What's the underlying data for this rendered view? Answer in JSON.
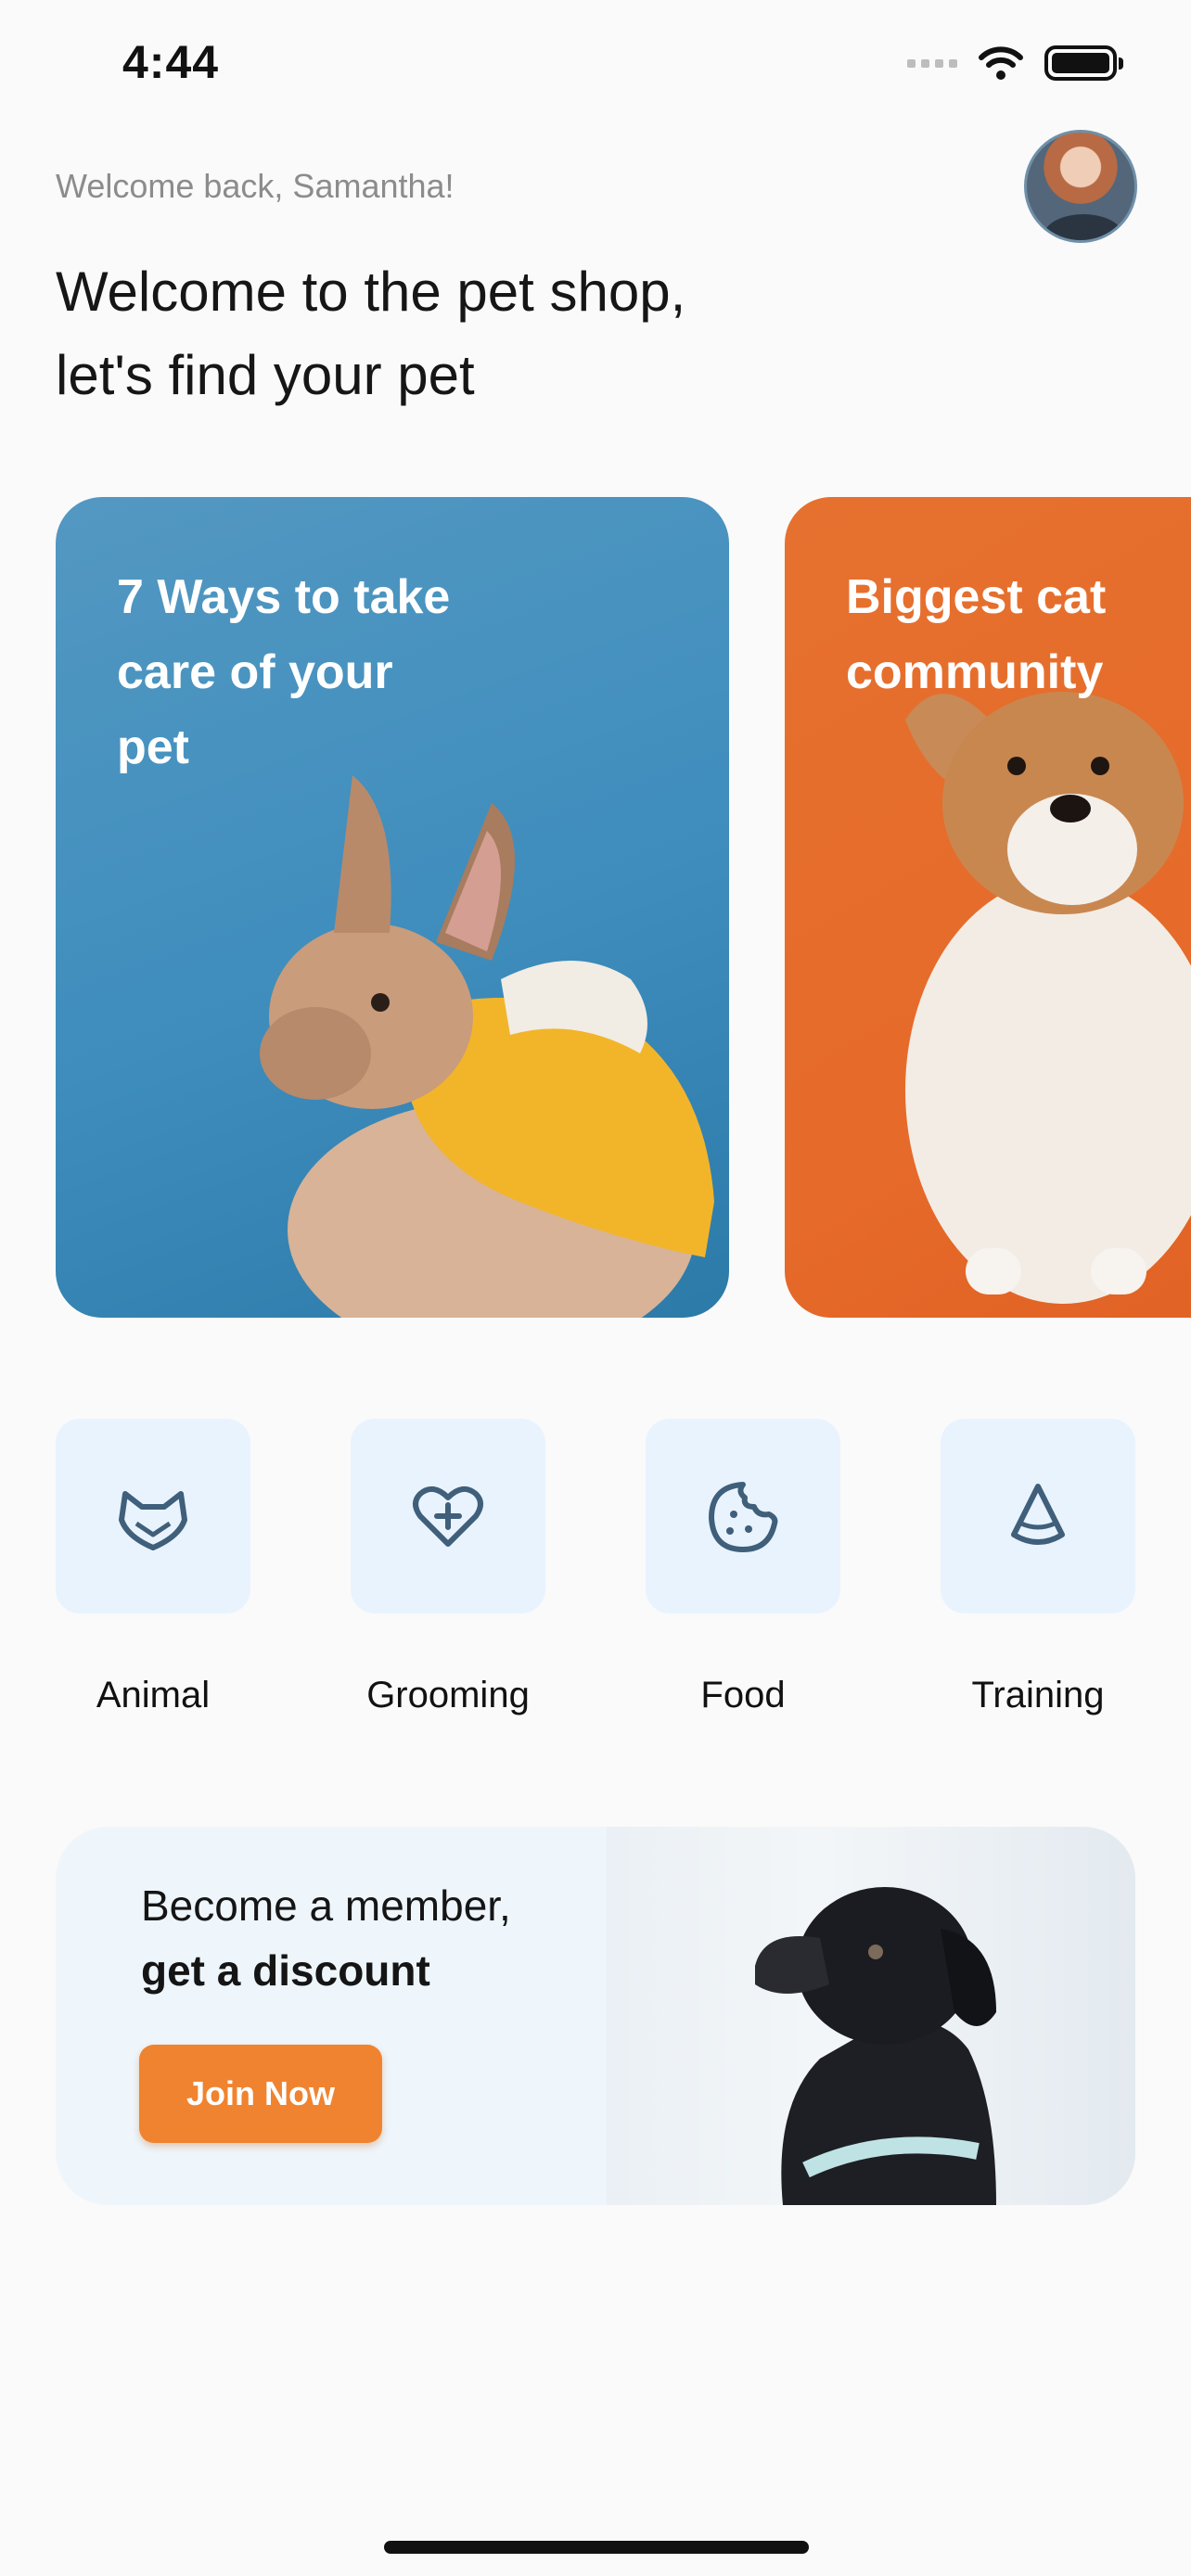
{
  "status_bar": {
    "time": "4:44"
  },
  "header": {
    "greeting": "Welcome back, Samantha!",
    "headline_line1": "Welcome to the pet shop,",
    "headline_line2": "let's find your pet"
  },
  "cards": [
    {
      "title_lines": [
        "7 Ways to take",
        "care of your",
        "pet"
      ],
      "color": "#4593c0"
    },
    {
      "title_lines": [
        "Biggest cat",
        "community"
      ],
      "color": "#e46b2c"
    }
  ],
  "categories": [
    {
      "label": "Animal",
      "icon": "cat-face-icon"
    },
    {
      "label": "Grooming",
      "icon": "heart-plus-icon"
    },
    {
      "label": "Food",
      "icon": "cookie-icon"
    },
    {
      "label": "Training",
      "icon": "cone-icon"
    }
  ],
  "banner": {
    "line1": "Become a member,",
    "line2": "get a discount",
    "button_label": "Join Now",
    "button_color": "#f0832f"
  },
  "colors": {
    "accent": "#f0832f",
    "category_bg": "#e8f3fe",
    "icon": "#3f5f7a"
  }
}
